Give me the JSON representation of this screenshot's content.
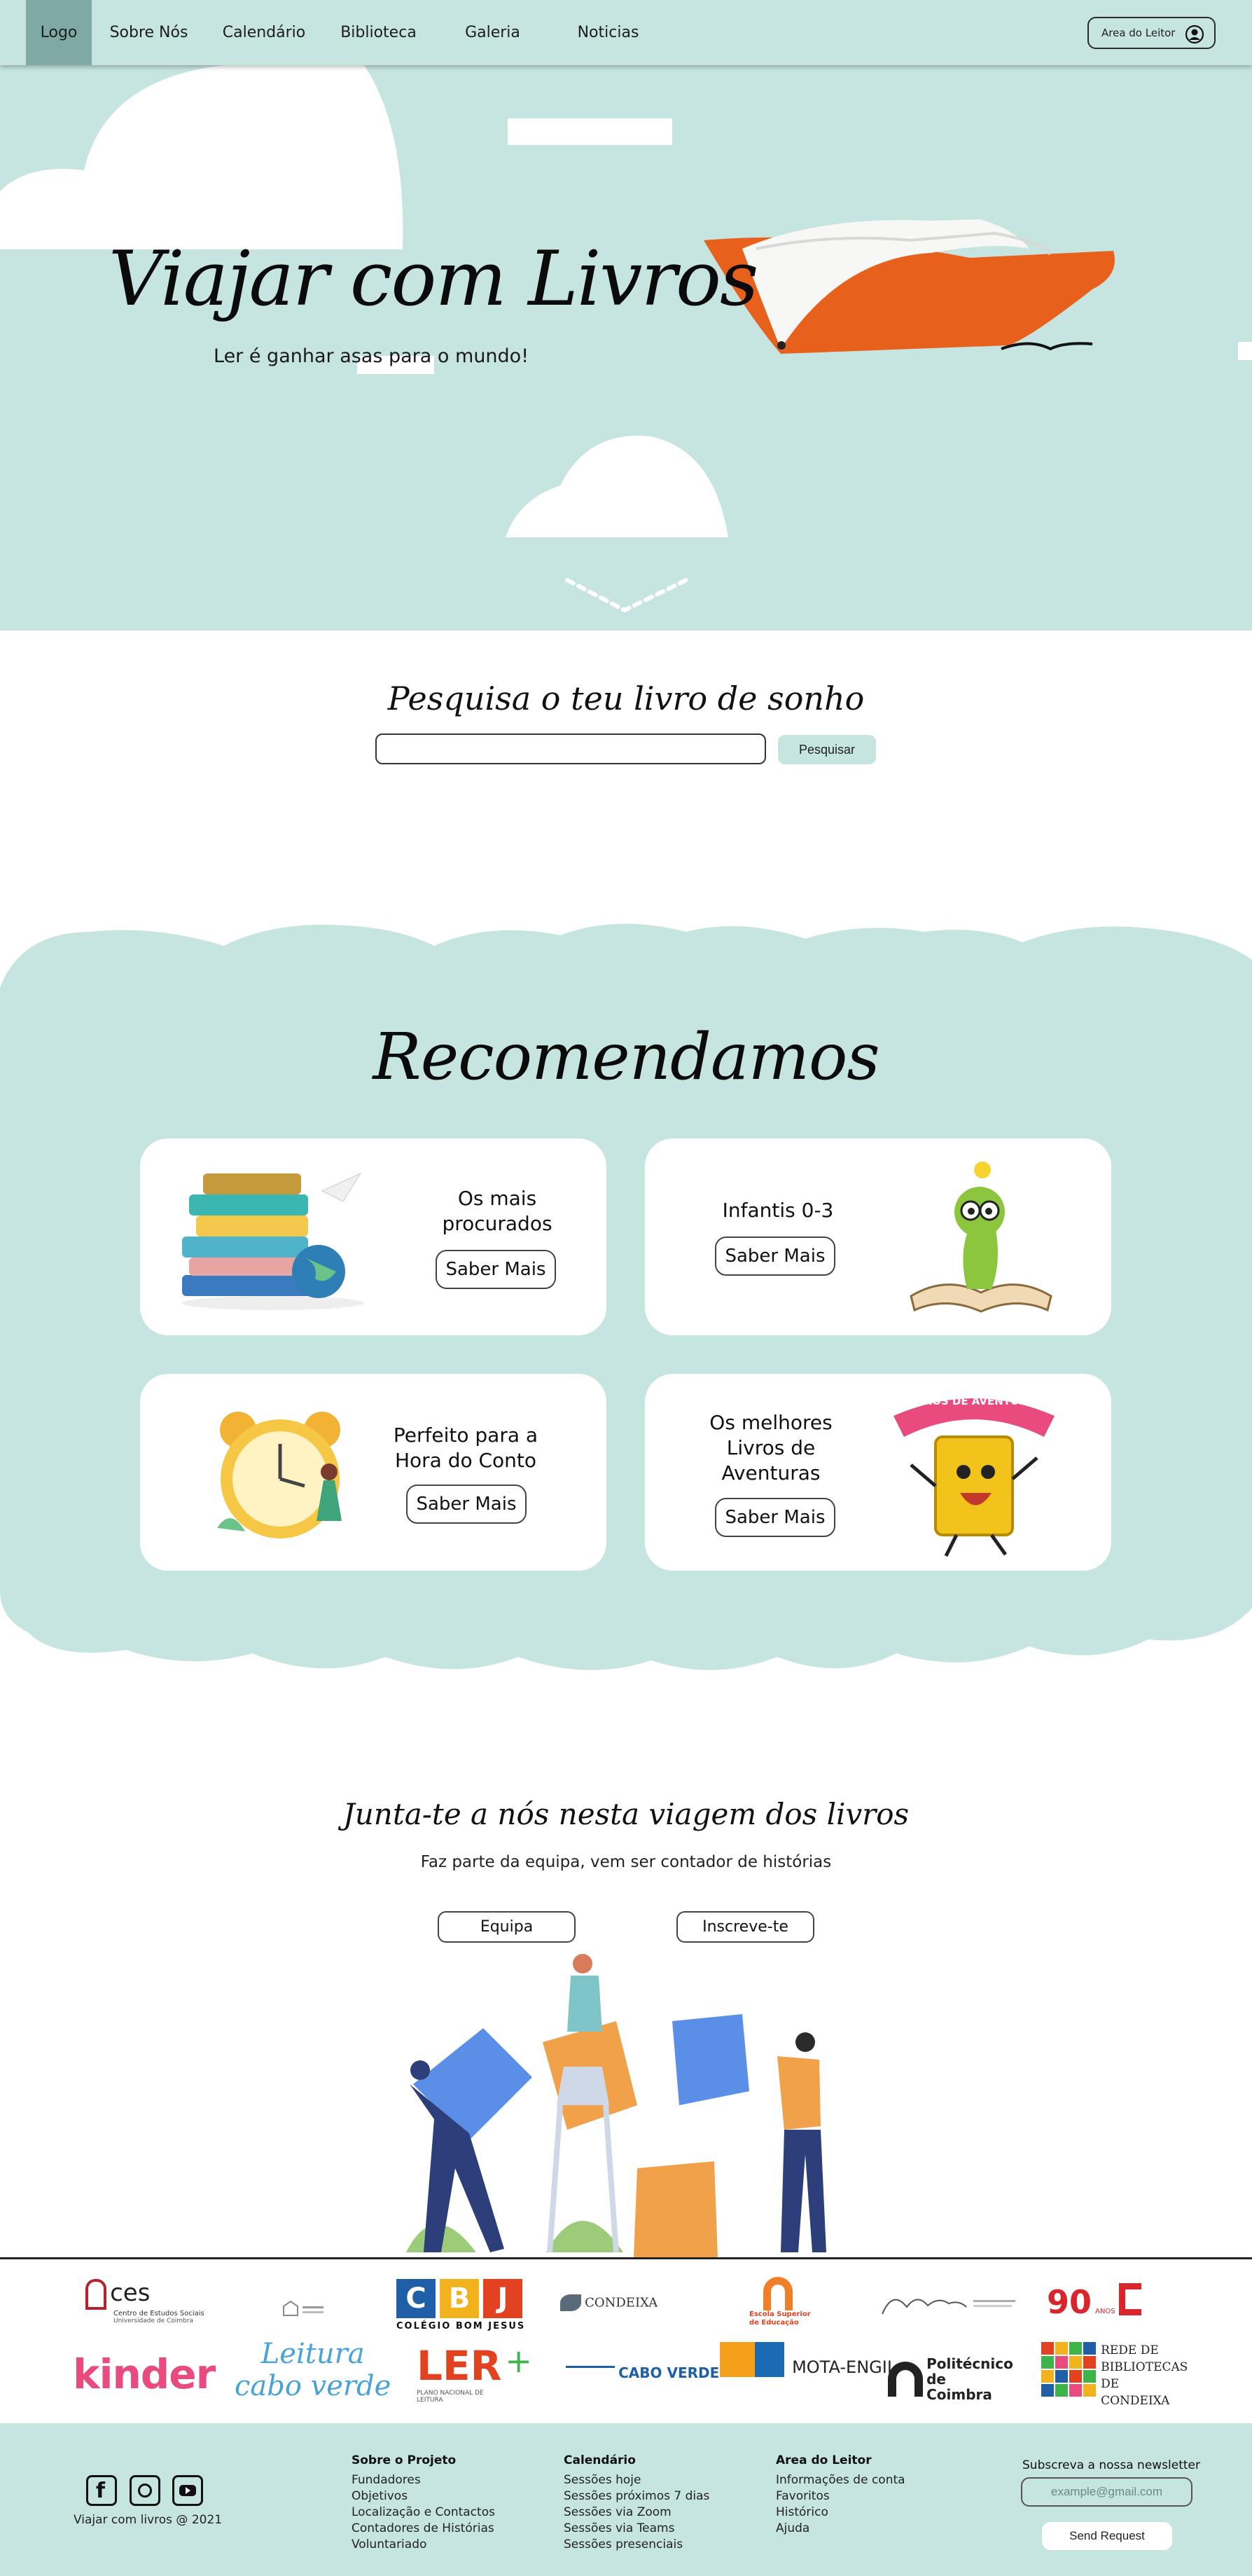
{
  "nav": {
    "logo": "Logo",
    "items": [
      "Sobre Nós",
      "Calendário",
      "Biblioteca",
      "Galeria",
      "Noticias"
    ],
    "reader_area": "Area do Leitor",
    "user_icon": "user-circle-icon"
  },
  "hero": {
    "title": "Viajar com Livros",
    "subtitle": "Ler é ganhar asas para o mundo!"
  },
  "search": {
    "title": "Pesquisa o teu livro de sonho",
    "value": "",
    "button": "Pesquisar"
  },
  "recommend": {
    "title": "Recomendamos",
    "cards": [
      {
        "text": "Os mais procurados",
        "button": "Saber Mais",
        "art": "book-stack-globe-icon"
      },
      {
        "text": "Infantis 0-3",
        "button": "Saber Mais",
        "art": "bookworm-icon"
      },
      {
        "text": "Perfeito para a Hora do Conto",
        "button": "Saber Mais",
        "art": "alarm-clock-icon"
      },
      {
        "text": "Os melhores Livros de Aventuras",
        "button": "Saber Mais",
        "art": "adventure-book-icon",
        "banner": "LIVROS DE AVENTURAS"
      }
    ]
  },
  "join": {
    "title": "Junta-te a nós nesta viagem dos livros",
    "subtitle": "Faz parte da equipa, vem ser contador de histórias",
    "buttons": [
      "Equipa",
      "Inscreve-te"
    ]
  },
  "partners": {
    "row1": [
      "ces",
      "Centro de Estudos Sociais",
      "Universidade de Coimbra",
      "C",
      "B",
      "J",
      "COLÉGIO BOM JESUS",
      "CONDEIXA",
      "Escola Superior de Educação",
      "90",
      "ANOS"
    ],
    "row2": [
      "kinder",
      "Leitura",
      "cabo verde",
      "LER",
      "PLANO NACIONAL DE LEITURA",
      "CABO VERDE",
      "MOTA-ENGIL",
      "Politécnico de Coimbra",
      "REDE DE BIBLIOTECAS DE CONDEIXA"
    ]
  },
  "footer": {
    "copyright": "Viajar com livros @ 2021",
    "social_icons": [
      "facebook-icon",
      "instagram-icon",
      "youtube-icon"
    ],
    "columns": [
      {
        "title": "Sobre o Projeto",
        "items": [
          "Fundadores",
          "Objetivos",
          "Localização e Contactos",
          "Contadores de Histórias",
          "Voluntariado"
        ]
      },
      {
        "title": "Calendário",
        "items": [
          "Sessões hoje",
          "Sessões próximos 7 dias",
          "Sessões via Zoom",
          "Sessões via Teams",
          "Sessões presenciais"
        ]
      },
      {
        "title": "Area do Leitor",
        "items": [
          "Informações de conta",
          "Favoritos",
          "Histórico",
          "Ajuda"
        ]
      }
    ],
    "newsletter": {
      "title": "Subscreva a nossa newsletter",
      "placeholder": "example@gmail.com",
      "button": "Send Request"
    }
  },
  "colors": {
    "mint": "#c6e4e0",
    "logo_bg": "#7fa9a4",
    "book_orange": "#e8611c"
  }
}
